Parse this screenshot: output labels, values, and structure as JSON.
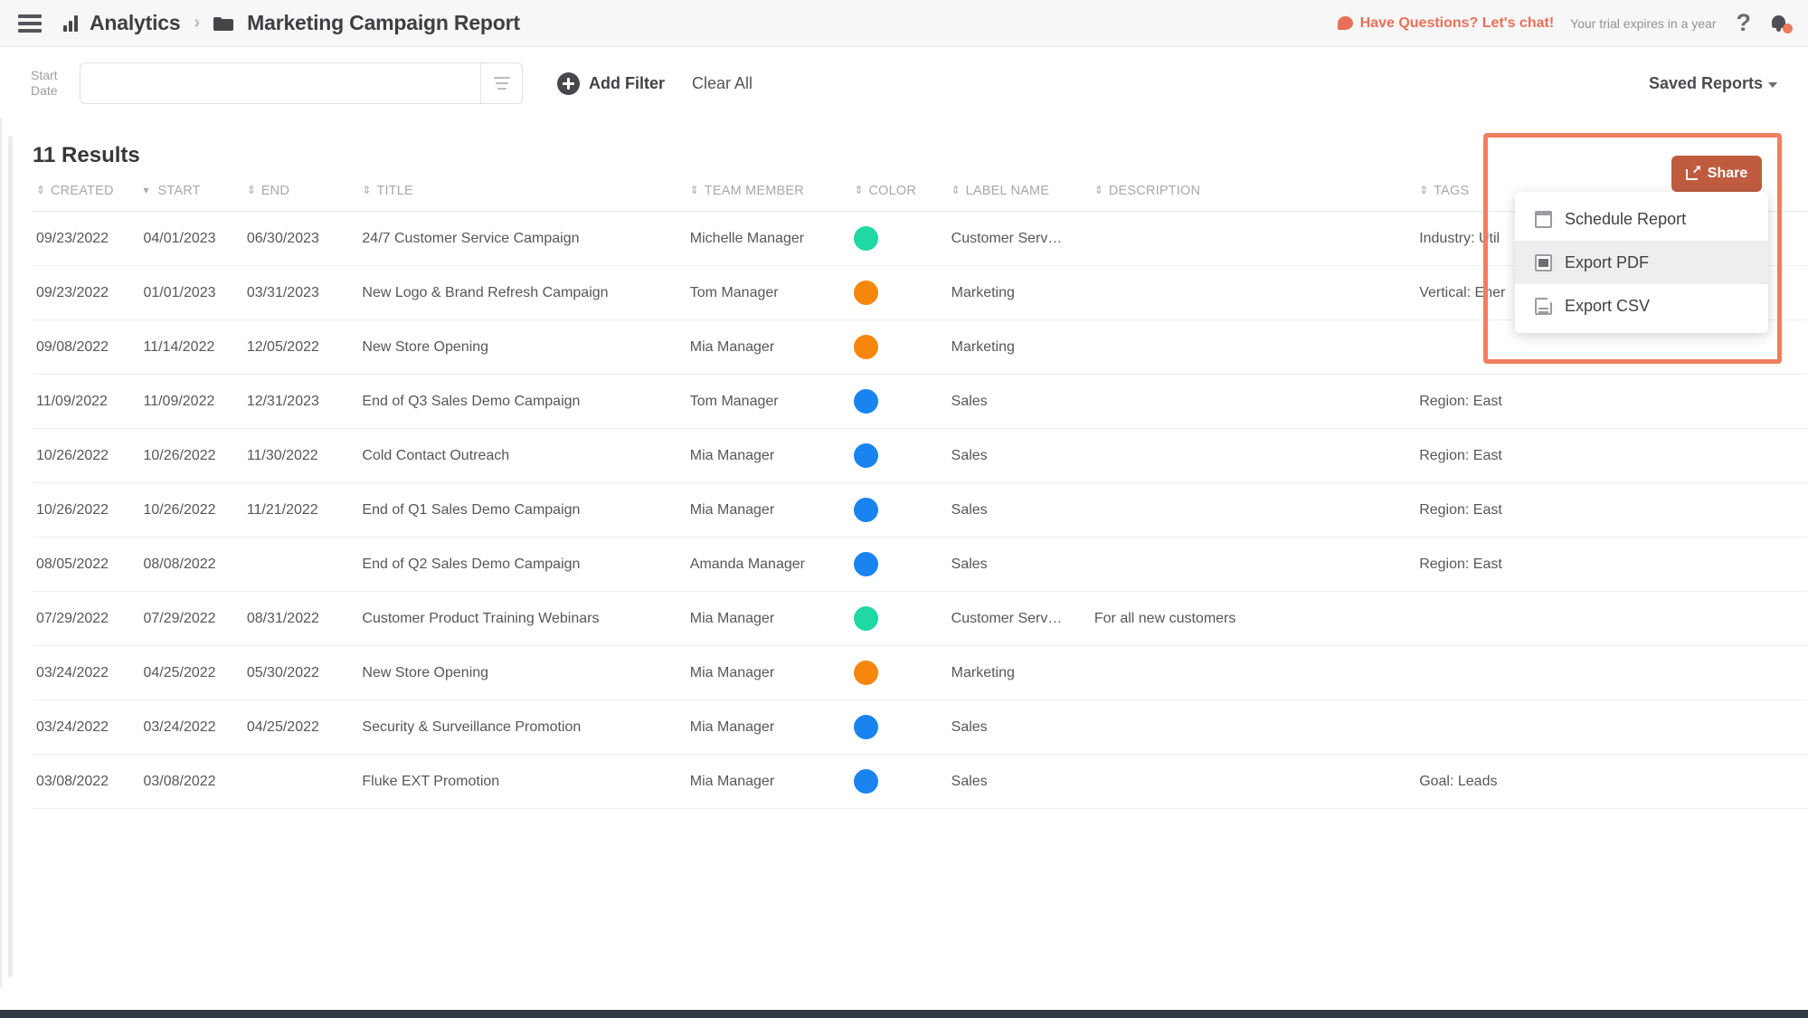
{
  "topbar": {
    "menu_icon": "hamburger-icon",
    "breadcrumb": {
      "app_icon": "bar-chart-icon",
      "app_label": "Analytics",
      "separator": "›",
      "folder_icon": "folder-icon",
      "page_label": "Marketing Campaign Report"
    },
    "chat_icon": "chat-bubble-icon",
    "chat_label": "Have Questions? Let's chat!",
    "trial_text": "Your trial expires in a year",
    "help_icon": "?",
    "bell_icon": "bell-icon",
    "accent_orange": "#e8705a"
  },
  "filterbar": {
    "start_date_label": "Start Date",
    "start_date_value": "",
    "start_date_placeholder": "",
    "options_icon": "filter-options-icon",
    "add_filter_label": "Add Filter",
    "clear_all_label": "Clear All",
    "saved_reports_label": "Saved Reports",
    "chevron_icon": "chevron-down-icon"
  },
  "results": {
    "count_label": "11 Results"
  },
  "share": {
    "button_label": "Share",
    "button_icon": "share-icon",
    "button_color": "#bf5c40",
    "highlight_color": "#ef7f5e",
    "menu": [
      {
        "label": "Schedule Report",
        "icon": "calendar-icon",
        "active": false
      },
      {
        "label": "Export PDF",
        "icon": "pdf-file-icon",
        "active": true
      },
      {
        "label": "Export CSV",
        "icon": "csv-file-icon",
        "active": false
      }
    ]
  },
  "table": {
    "columns": [
      {
        "key": "created",
        "label": "Created",
        "sort": "both"
      },
      {
        "key": "start",
        "label": "Start",
        "sort": "desc"
      },
      {
        "key": "end",
        "label": "End",
        "sort": "both"
      },
      {
        "key": "title",
        "label": "Title",
        "sort": "both"
      },
      {
        "key": "team_member",
        "label": "Team Member",
        "sort": "both"
      },
      {
        "key": "color",
        "label": "Color",
        "sort": "both"
      },
      {
        "key": "label_name",
        "label": "Label Name",
        "sort": "both"
      },
      {
        "key": "description",
        "label": "Description",
        "sort": "both"
      },
      {
        "key": "tags",
        "label": "Tags",
        "sort": "both"
      }
    ],
    "rows": [
      {
        "created": "09/23/2022",
        "start": "04/01/2023",
        "end": "06/30/2023",
        "title": "24/7 Customer Service Campaign",
        "team_member": "Michelle Manager",
        "color": "#1fd8a4",
        "label_name": "Customer Serv…",
        "description": "",
        "tags": "Industry: Util"
      },
      {
        "created": "09/23/2022",
        "start": "01/01/2023",
        "end": "03/31/2023",
        "title": "New Logo & Brand Refresh Campaign",
        "team_member": "Tom Manager",
        "color": "#f7860d",
        "label_name": "Marketing",
        "description": "",
        "tags": "Vertical: Ener"
      },
      {
        "created": "09/08/2022",
        "start": "11/14/2022",
        "end": "12/05/2022",
        "title": "New Store Opening",
        "team_member": "Mia Manager",
        "color": "#f7860d",
        "label_name": "Marketing",
        "description": "",
        "tags": ""
      },
      {
        "created": "11/09/2022",
        "start": "11/09/2022",
        "end": "12/31/2023",
        "title": "End of Q3 Sales Demo Campaign",
        "team_member": "Tom Manager",
        "color": "#1984f0",
        "label_name": "Sales",
        "description": "",
        "tags": "Region: East"
      },
      {
        "created": "10/26/2022",
        "start": "10/26/2022",
        "end": "11/30/2022",
        "title": "Cold Contact Outreach",
        "team_member": "Mia Manager",
        "color": "#1984f0",
        "label_name": "Sales",
        "description": "",
        "tags": "Region: East"
      },
      {
        "created": "10/26/2022",
        "start": "10/26/2022",
        "end": "11/21/2022",
        "title": "End of Q1 Sales Demo Campaign",
        "team_member": "Mia Manager",
        "color": "#1984f0",
        "label_name": "Sales",
        "description": "",
        "tags": "Region: East"
      },
      {
        "created": "08/05/2022",
        "start": "08/08/2022",
        "end": "",
        "title": "End of Q2 Sales Demo Campaign",
        "team_member": "Amanda Manager",
        "color": "#1984f0",
        "label_name": "Sales",
        "description": "",
        "tags": "Region: East"
      },
      {
        "created": "07/29/2022",
        "start": "07/29/2022",
        "end": "08/31/2022",
        "title": "Customer Product Training Webinars",
        "team_member": "Mia Manager",
        "color": "#1fd8a4",
        "label_name": "Customer Serv…",
        "description": "For all new customers",
        "tags": ""
      },
      {
        "created": "03/24/2022",
        "start": "04/25/2022",
        "end": "05/30/2022",
        "title": "New Store Opening",
        "team_member": "Mia Manager",
        "color": "#f7860d",
        "label_name": "Marketing",
        "description": "",
        "tags": ""
      },
      {
        "created": "03/24/2022",
        "start": "03/24/2022",
        "end": "04/25/2022",
        "title": "Security & Surveillance Promotion",
        "team_member": "Mia Manager",
        "color": "#1984f0",
        "label_name": "Sales",
        "description": "",
        "tags": ""
      },
      {
        "created": "03/08/2022",
        "start": "03/08/2022",
        "end": "",
        "title": "Fluke EXT Promotion",
        "team_member": "Mia Manager",
        "color": "#1984f0",
        "label_name": "Sales",
        "description": "",
        "tags": "Goal: Leads"
      }
    ]
  }
}
